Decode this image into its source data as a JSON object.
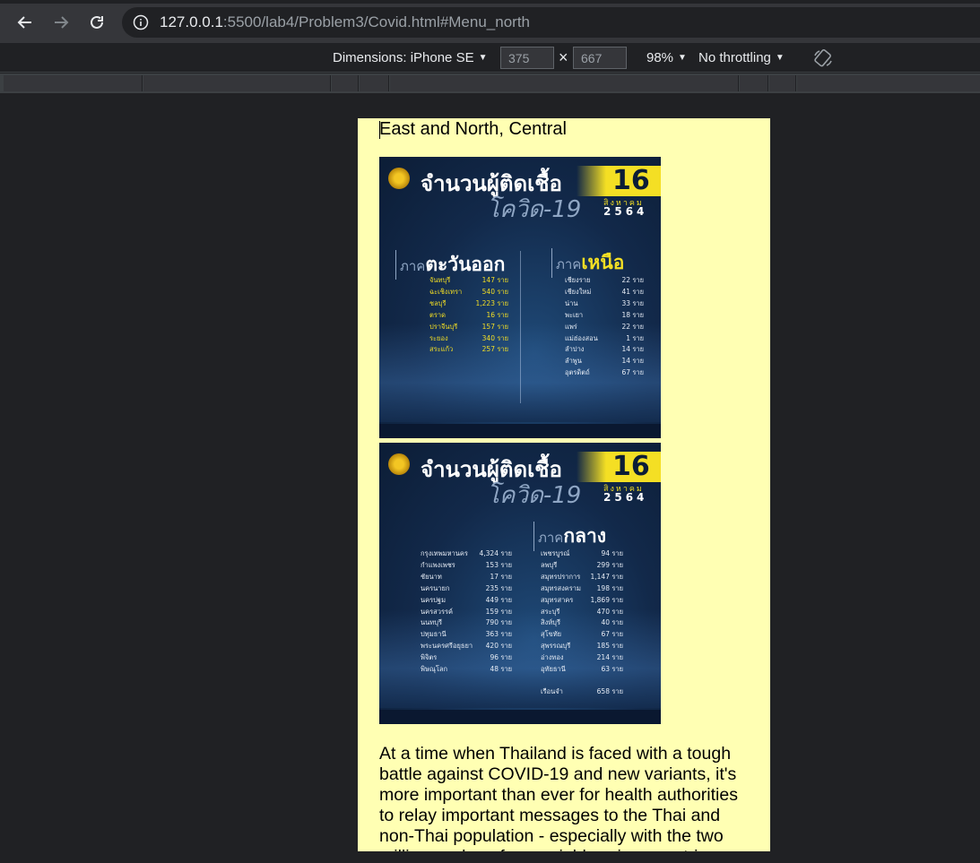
{
  "browser": {
    "url_host": "127.0.0.1",
    "url_rest": ":5500/lab4/Problem3/Covid.html#Menu_north"
  },
  "device_toolbar": {
    "dimensions_label": "Dimensions: iPhone SE",
    "width": "375",
    "times": "×",
    "height": "667",
    "zoom": "98%",
    "throttling": "No throttling"
  },
  "page": {
    "heading": "East and North, Central",
    "poster_east_north": {
      "title": "จำนวนผู้ติดเชื้อ",
      "day": "16",
      "subtitle": "โควิด-19",
      "month": "สิงหาคม",
      "year": "2564",
      "region_left_prefix": "ภาค",
      "region_left": "ตะวันออก",
      "region_right_prefix": "ภาค",
      "region_right": "เหนือ",
      "east": [
        {
          "name": "จันทบุรี",
          "value": "147 ราย"
        },
        {
          "name": "ฉะเชิงเทรา",
          "value": "540 ราย"
        },
        {
          "name": "ชลบุรี",
          "value": "1,223 ราย"
        },
        {
          "name": "ตราด",
          "value": "16 ราย"
        },
        {
          "name": "ปราจีนบุรี",
          "value": "157 ราย"
        },
        {
          "name": "ระยอง",
          "value": "340 ราย"
        },
        {
          "name": "สระแก้ว",
          "value": "257 ราย"
        }
      ],
      "north": [
        {
          "name": "เชียงราย",
          "value": "22 ราย"
        },
        {
          "name": "เชียงใหม่",
          "value": "41 ราย"
        },
        {
          "name": "น่าน",
          "value": "33 ราย"
        },
        {
          "name": "พะเยา",
          "value": "18 ราย"
        },
        {
          "name": "แพร่",
          "value": "22 ราย"
        },
        {
          "name": "แม่ฮ่องสอน",
          "value": "1 ราย"
        },
        {
          "name": "ลำปาง",
          "value": "14 ราย"
        },
        {
          "name": "ลำพูน",
          "value": "14 ราย"
        },
        {
          "name": "อุตรดิตถ์",
          "value": "67 ราย"
        }
      ]
    },
    "poster_central": {
      "title": "จำนวนผู้ติดเชื้อ",
      "day": "16",
      "subtitle": "โควิด-19",
      "month": "สิงหาคม",
      "year": "2564",
      "region_prefix": "ภาค",
      "region": "กลาง",
      "left": [
        {
          "name": "กรุงเทพมหานคร",
          "value": "4,324 ราย"
        },
        {
          "name": "กำแพงเพชร",
          "value": "153 ราย"
        },
        {
          "name": "ชัยนาท",
          "value": "17 ราย"
        },
        {
          "name": "นครนายก",
          "value": "235 ราย"
        },
        {
          "name": "นครปฐม",
          "value": "449 ราย"
        },
        {
          "name": "นครสวรรค์",
          "value": "159 ราย"
        },
        {
          "name": "นนทบุรี",
          "value": "790 ราย"
        },
        {
          "name": "ปทุมธานี",
          "value": "363 ราย"
        },
        {
          "name": "พระนครศรีอยุธยา",
          "value": "420 ราย"
        },
        {
          "name": "พิจิตร",
          "value": "96 ราย"
        },
        {
          "name": "พิษณุโลก",
          "value": "48 ราย"
        }
      ],
      "right": [
        {
          "name": "เพชรบูรณ์",
          "value": "94 ราย"
        },
        {
          "name": "ลพบุรี",
          "value": "299 ราย"
        },
        {
          "name": "สมุทรปราการ",
          "value": "1,147 ราย"
        },
        {
          "name": "สมุทรสงคราม",
          "value": "198 ราย"
        },
        {
          "name": "สมุทรสาคร",
          "value": "1,869 ราย"
        },
        {
          "name": "สระบุรี",
          "value": "470 ราย"
        },
        {
          "name": "สิงห์บุรี",
          "value": "40 ราย"
        },
        {
          "name": "สุโขทัย",
          "value": "67 ราย"
        },
        {
          "name": "สุพรรณบุรี",
          "value": "185 ราย"
        },
        {
          "name": "อ่างทอง",
          "value": "214 ราย"
        },
        {
          "name": "อุทัยธานี",
          "value": "63 ราย"
        },
        {
          "name": "เรือนจำ",
          "value": "658 ราย"
        }
      ]
    },
    "paragraph": "At a time when Thailand is faced with a tough battle against COVID-19 and new variants, it's more important than ever for health authorities to relay important messages to the Thai and non-Thai population - especially with the two million workers from neighbouring countries"
  }
}
